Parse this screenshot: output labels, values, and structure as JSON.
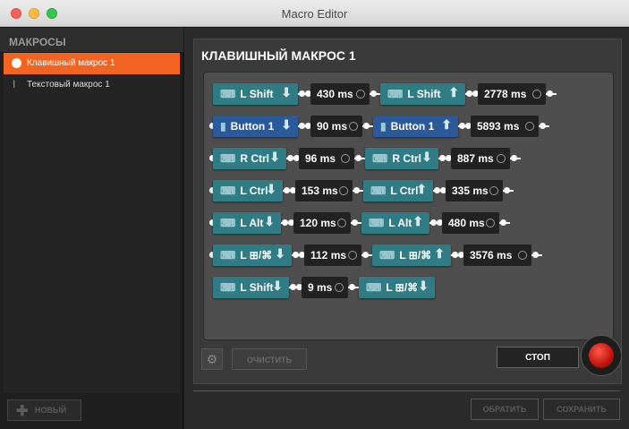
{
  "window": {
    "title": "Macro Editor"
  },
  "sidebar": {
    "header": "МАКРОСЫ",
    "items": [
      {
        "label": "Клавишный макрос 1",
        "active": true,
        "icon": "bullet-icon"
      },
      {
        "label": "Текстовый макрос 1",
        "active": false,
        "icon": "ibeam-icon"
      }
    ],
    "new_button": "НОВЫЙ"
  },
  "editor": {
    "title": "КЛАВИШНЫЙ МАКРОС 1",
    "rows": [
      {
        "start_dot": false,
        "events": [
          {
            "kind": "key",
            "label": "L Shift",
            "icon": "keyboard-icon",
            "dir": "down",
            "color": "teal"
          },
          {
            "kind": "delay",
            "label": "430 ms"
          },
          {
            "kind": "key",
            "label": "L Shift",
            "icon": "keyboard-icon",
            "dir": "up",
            "color": "teal"
          },
          {
            "kind": "delay",
            "label": "2778 ms"
          }
        ]
      },
      {
        "start_dot": true,
        "events": [
          {
            "kind": "key",
            "label": "Button 1",
            "icon": "mouse-icon",
            "dir": "down",
            "color": "blue"
          },
          {
            "kind": "delay",
            "label": "90 ms"
          },
          {
            "kind": "key",
            "label": "Button 1",
            "icon": "mouse-icon",
            "dir": "up",
            "color": "blue"
          },
          {
            "kind": "delay",
            "label": "5893 ms"
          }
        ]
      },
      {
        "start_dot": true,
        "events": [
          {
            "kind": "key",
            "label": "R Ctrl",
            "icon": "keyboard-icon",
            "dir": "down",
            "color": "teal"
          },
          {
            "kind": "delay",
            "label": "96 ms"
          },
          {
            "kind": "key",
            "label": "R Ctrl",
            "icon": "keyboard-icon",
            "dir": "down",
            "color": "teal"
          },
          {
            "kind": "delay",
            "label": "887 ms"
          }
        ]
      },
      {
        "start_dot": true,
        "events": [
          {
            "kind": "key",
            "label": "L Ctrl",
            "icon": "keyboard-icon",
            "dir": "down",
            "color": "teal"
          },
          {
            "kind": "delay",
            "label": "153 ms"
          },
          {
            "kind": "key",
            "label": "L Ctrl",
            "icon": "keyboard-icon",
            "dir": "up",
            "color": "teal"
          },
          {
            "kind": "delay",
            "label": "335 ms"
          }
        ]
      },
      {
        "start_dot": true,
        "events": [
          {
            "kind": "key",
            "label": "L Alt",
            "icon": "keyboard-icon",
            "dir": "down",
            "color": "teal"
          },
          {
            "kind": "delay",
            "label": "120 ms"
          },
          {
            "kind": "key",
            "label": "L Alt",
            "icon": "keyboard-icon",
            "dir": "up",
            "color": "teal"
          },
          {
            "kind": "delay",
            "label": "480 ms"
          }
        ]
      },
      {
        "start_dot": true,
        "events": [
          {
            "kind": "key",
            "label": "L ⊞/⌘",
            "icon": "keyboard-icon",
            "dir": "down",
            "color": "teal"
          },
          {
            "kind": "delay",
            "label": "112 ms"
          },
          {
            "kind": "key",
            "label": "L ⊞/⌘",
            "icon": "keyboard-icon",
            "dir": "up",
            "color": "teal"
          },
          {
            "kind": "delay",
            "label": "3576 ms"
          }
        ]
      },
      {
        "start_dot": false,
        "events": [
          {
            "kind": "key",
            "label": "L Shift",
            "icon": "keyboard-icon",
            "dir": "down",
            "color": "teal"
          },
          {
            "kind": "delay",
            "label": "9 ms"
          },
          {
            "kind": "key",
            "label": "L ⊞/⌘",
            "icon": "keyboard-icon",
            "dir": "down",
            "color": "teal"
          }
        ]
      }
    ],
    "clear_button": "ОЧИСТИТЬ",
    "stop_button": "СТОП"
  },
  "footer": {
    "revert_button": "ОБРАТИТЬ",
    "save_button": "СОХРАНИТЬ"
  }
}
